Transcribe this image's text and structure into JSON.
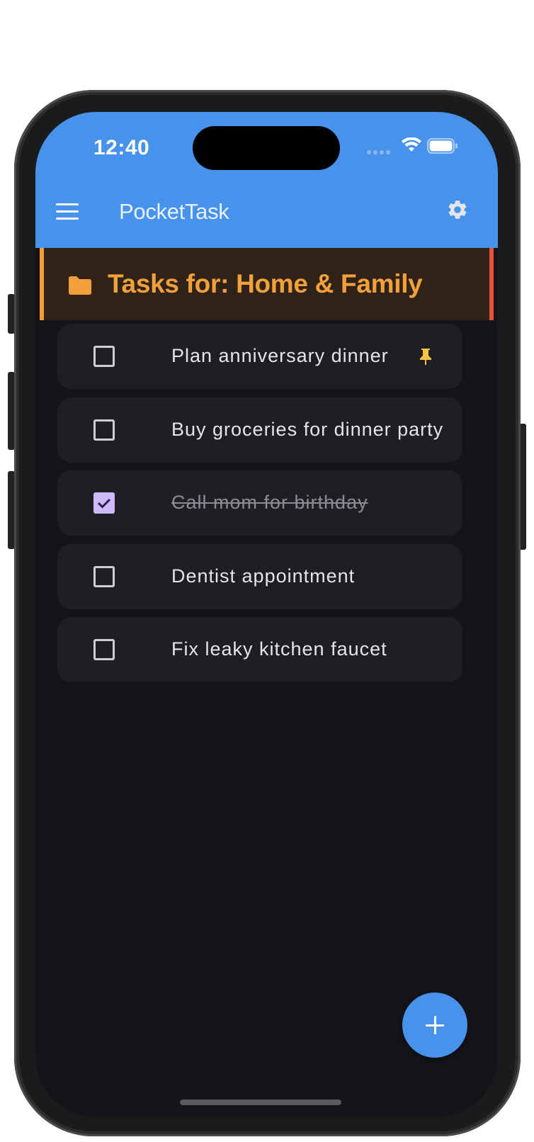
{
  "status_bar": {
    "time": "12:40"
  },
  "app_bar": {
    "title": "PocketTask",
    "menu_icon": "menu-icon",
    "settings_icon": "gear-icon",
    "color": "#4793ec"
  },
  "category": {
    "title": "Tasks for: Home & Family",
    "icon": "folder-icon",
    "accent_color": "#f3a03c"
  },
  "tasks": [
    {
      "label": "Plan anniversary dinner",
      "completed": false,
      "pinned": true
    },
    {
      "label": "Buy groceries for dinner party",
      "completed": false,
      "pinned": false
    },
    {
      "label": "Call mom for birthday",
      "completed": true,
      "pinned": false
    },
    {
      "label": "Dentist appointment",
      "completed": false,
      "pinned": false
    },
    {
      "label": "Fix leaky kitchen faucet",
      "completed": false,
      "pinned": false
    }
  ],
  "fab": {
    "icon": "plus-icon",
    "color": "#4793ec"
  },
  "colors": {
    "background": "#151419",
    "card": "#1f1e23",
    "checked": "#cdb9fb",
    "pin": "#f5c542"
  }
}
